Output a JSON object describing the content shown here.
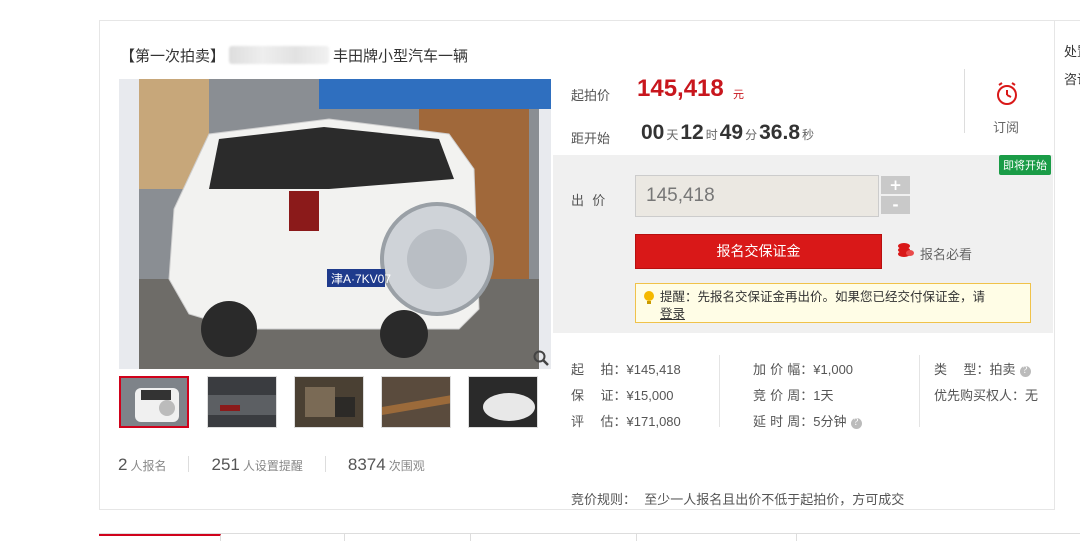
{
  "title": {
    "prefix": "【第一次拍卖】",
    "suffix": "丰田牌小型汽车一辆"
  },
  "photo": {
    "plate_text": "津A·7KV07"
  },
  "stats": [
    {
      "num": "2",
      "label": "人报名"
    },
    {
      "num": "251",
      "label": "人设置提醒"
    },
    {
      "num": "8374",
      "label": "次围观"
    }
  ],
  "price": {
    "start_label": "起拍价",
    "start_value": "145,418",
    "start_unit": "元",
    "countdown_label": "距开始",
    "days": "00",
    "days_unit": "天",
    "hours": "12",
    "hours_unit": "时",
    "minutes": "49",
    "minutes_unit": "分",
    "seconds": "36.8",
    "seconds_unit": "秒",
    "subscribe": "订阅"
  },
  "bid": {
    "badge": "即将开始",
    "label": "出  价",
    "value": "145,418",
    "plus": "+",
    "minus": "-",
    "deposit_button": "报名交保证金",
    "must_read": "报名必看",
    "tip_text": "提醒：先报名交保证金再出价。如果您已经交付保证金，请",
    "tip_link": "登录"
  },
  "info": {
    "col1": [
      {
        "k": "起    拍：",
        "v": "¥145,418"
      },
      {
        "k": "保    证：",
        "v": "¥15,000"
      },
      {
        "k": "评    估：",
        "v": "¥171,080"
      }
    ],
    "col2": [
      {
        "k": "加 价 幅：",
        "v": "¥1,000"
      },
      {
        "k": "竞 价 周：",
        "v": "1天"
      },
      {
        "k": "延 时 周：",
        "v": "5分钟"
      }
    ],
    "col3": [
      {
        "k": "类    型：",
        "v": "拍卖"
      },
      {
        "k": "优先购买权人：",
        "v": "无"
      }
    ],
    "rule_label": "竞价规则：",
    "rule_text": "至少一人报名且出价不低于起拍价，方可成交"
  },
  "side": {
    "line1": "处置",
    "line2": "咨询"
  },
  "colors": {
    "accent_red": "#d91818",
    "price_red": "#c8161d",
    "badge_green": "#1a9c47"
  }
}
